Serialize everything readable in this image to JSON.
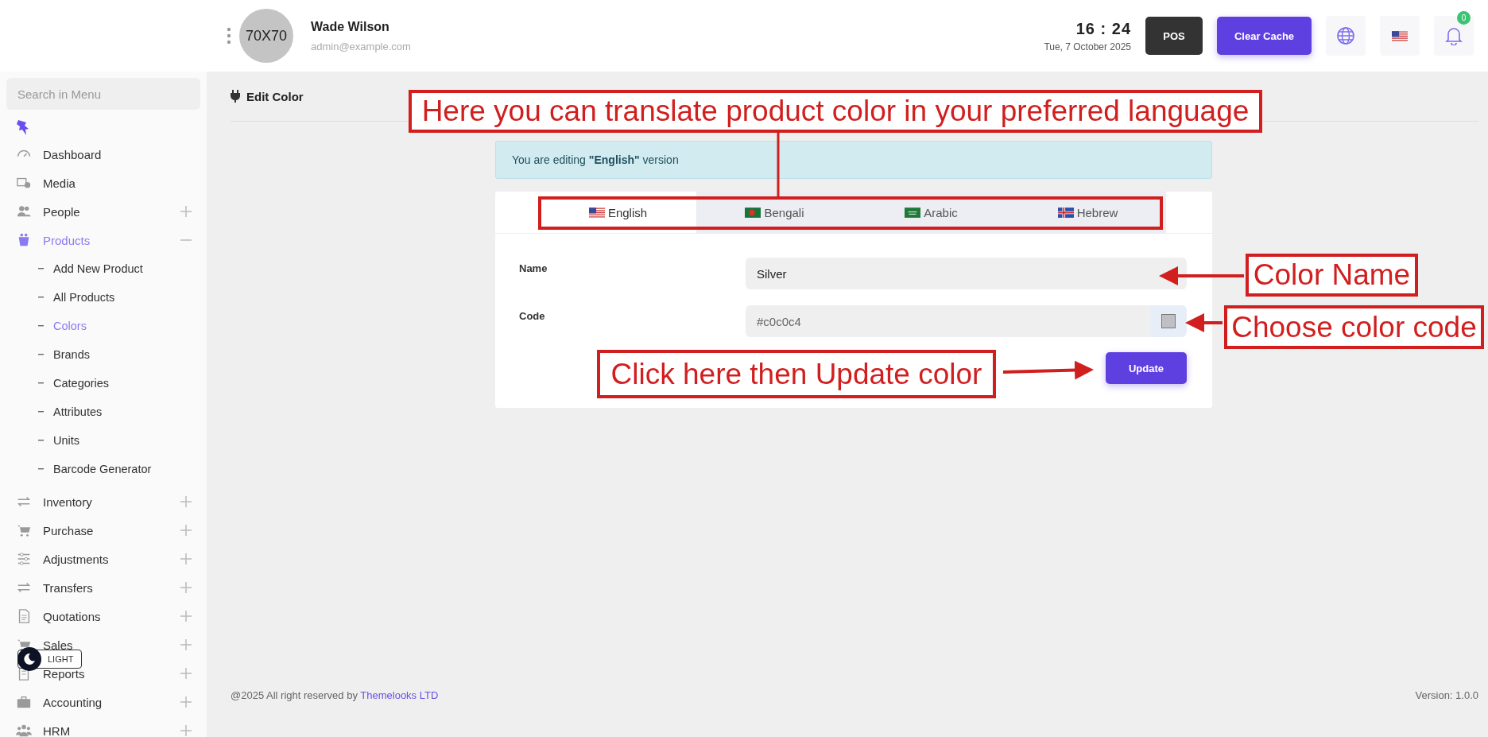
{
  "header": {
    "avatar_text": "70X70",
    "user_name": "Wade Wilson",
    "user_email": "admin@example.com",
    "time": "16 : 24",
    "date": "Tue, 7 October 2025",
    "buttons": [
      "POS",
      "Clear Cache"
    ],
    "notification_count": "0"
  },
  "sidebar": {
    "search_placeholder": "Search in Menu",
    "items": [
      {
        "label": "Dashboard",
        "kind": "link",
        "selected": false
      },
      {
        "label": "Media",
        "kind": "link",
        "selected": false
      },
      {
        "label": "People",
        "kind": "group",
        "selected": false,
        "expanded": false
      },
      {
        "label": "Products",
        "kind": "group",
        "selected": true,
        "expanded": true,
        "children": [
          {
            "label": "Add New Product",
            "selected": false
          },
          {
            "label": "All Products",
            "selected": false
          },
          {
            "label": "Colors",
            "selected": true
          },
          {
            "label": "Brands",
            "selected": false
          },
          {
            "label": "Categories",
            "selected": false
          },
          {
            "label": "Attributes",
            "selected": false
          },
          {
            "label": "Units",
            "selected": false
          },
          {
            "label": "Barcode Generator",
            "selected": false
          }
        ]
      },
      {
        "label": "Inventory",
        "kind": "group",
        "selected": false,
        "expanded": false
      },
      {
        "label": "Purchase",
        "kind": "group",
        "selected": false,
        "expanded": false
      },
      {
        "label": "Adjustments",
        "kind": "group",
        "selected": false,
        "expanded": false
      },
      {
        "label": "Transfers",
        "kind": "group",
        "selected": false,
        "expanded": false
      },
      {
        "label": "Quotations",
        "kind": "group",
        "selected": false,
        "expanded": false
      },
      {
        "label": "Sales",
        "kind": "group",
        "selected": false,
        "expanded": false
      },
      {
        "label": "Reports",
        "kind": "group",
        "selected": false,
        "expanded": false
      },
      {
        "label": "Accounting",
        "kind": "group",
        "selected": false,
        "expanded": false
      },
      {
        "label": "HRM",
        "kind": "group",
        "selected": false,
        "expanded": false
      }
    ],
    "theme_toggle": "LIGHT"
  },
  "page": {
    "title": "Edit Color",
    "alert": "You are editing **\"English\"** version",
    "tabs": [
      {
        "label": "English",
        "selected": true
      },
      {
        "label": "Bengali",
        "selected": false
      },
      {
        "label": "Arabic",
        "selected": false
      },
      {
        "label": "Hebrew",
        "selected": false
      }
    ],
    "fields": [
      {
        "label": "Name",
        "value": "Silver",
        "kind": "text"
      },
      {
        "label": "Code",
        "value": "#c0c0c4",
        "kind": "color"
      }
    ],
    "submit": "Update"
  },
  "footer": {
    "copyright": "@2025 All right reserved by",
    "company": "Themelooks LTD",
    "version": "Version: 1.0.0"
  },
  "annotations": [
    "Here you can translate product color in your preferred language",
    "Color Name",
    "Choose color code",
    "Click here then Update color"
  ]
}
